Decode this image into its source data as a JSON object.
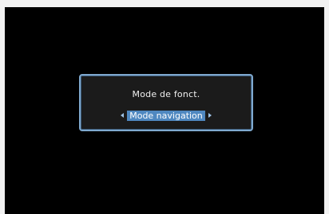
{
  "dialog": {
    "title": "Mode de fonct.",
    "selected_value": "Mode navigation",
    "left_icon": "triangle-left",
    "right_icon": "triangle-right"
  },
  "colors": {
    "screen_background": "#000000",
    "dialog_border": "#7fa9cf",
    "selection_highlight": "#4f88c0",
    "text": "#f0f0f0"
  }
}
